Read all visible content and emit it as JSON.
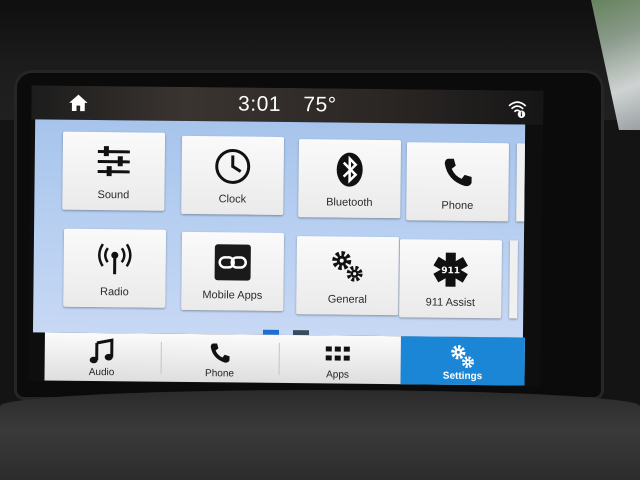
{
  "status": {
    "time": "3:01",
    "temperature": "75°"
  },
  "tiles": [
    {
      "label": "Sound",
      "icon": "sliders-icon"
    },
    {
      "label": "Clock",
      "icon": "clock-icon"
    },
    {
      "label": "Bluetooth",
      "icon": "bluetooth-icon"
    },
    {
      "label": "Phone",
      "icon": "phone-icon"
    },
    {
      "label": "Radio",
      "icon": "radio-antenna-icon"
    },
    {
      "label": "Mobile Apps",
      "icon": "link-icon"
    },
    {
      "label": "General",
      "icon": "gears-icon"
    },
    {
      "label": "911 Assist",
      "icon": "star-of-life-911-icon"
    }
  ],
  "pager": {
    "active_color": "#1f6fd1",
    "inactive_color": "#3c4a60"
  },
  "nav": [
    {
      "label": "Audio",
      "icon": "music-note-icon"
    },
    {
      "label": "Phone",
      "icon": "phone-icon"
    },
    {
      "label": "Apps",
      "icon": "apps-grid-icon"
    },
    {
      "label": "Settings",
      "icon": "gears-icon",
      "active": true
    }
  ],
  "colors": {
    "settings_active": "#1b86d6",
    "tile_area": "#b3cdf0"
  }
}
